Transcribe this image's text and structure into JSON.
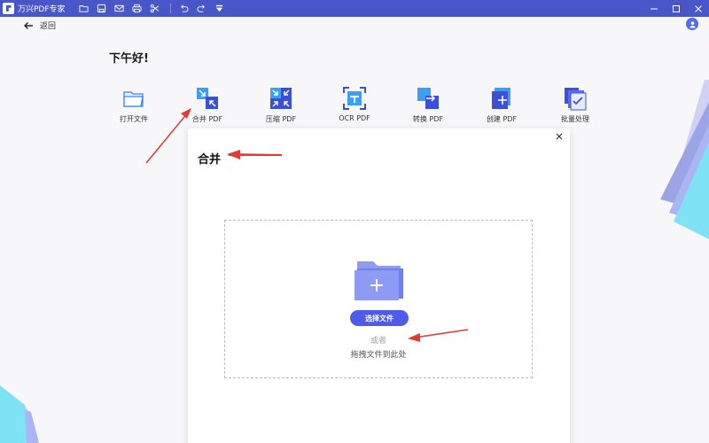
{
  "titlebar": {
    "app_name": "万兴PDF专家",
    "icons": [
      "folder-icon",
      "save-icon",
      "mail-icon",
      "print-icon",
      "cut-icon",
      "undo-icon",
      "redo-icon",
      "dropdown-icon"
    ],
    "window_controls": [
      "minimize-icon",
      "maximize-icon",
      "close-icon"
    ]
  },
  "nav": {
    "back_label": "返回"
  },
  "greeting": "下午好!",
  "tools": [
    {
      "label": "打开文件",
      "icon": "open-folder-icon"
    },
    {
      "label": "合并 PDF",
      "icon": "merge-icon"
    },
    {
      "label": "压缩 PDF",
      "icon": "compress-icon"
    },
    {
      "label": "OCR PDF",
      "icon": "ocr-icon"
    },
    {
      "label": "转换 PDF",
      "icon": "convert-icon"
    },
    {
      "label": "创建 PDF",
      "icon": "create-icon"
    },
    {
      "label": "批量处理",
      "icon": "batch-icon"
    }
  ],
  "dialog": {
    "title": "合并",
    "select_button": "选择文件",
    "or_text": "或者",
    "drag_text": "拖拽文件到此处"
  },
  "colors": {
    "titlebar": "#4856c8",
    "accent": "#4f5bea",
    "annotation": "#e53935"
  }
}
